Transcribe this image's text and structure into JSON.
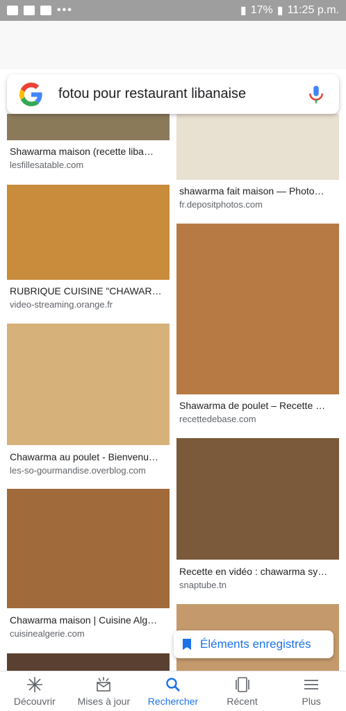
{
  "status_bar": {
    "battery": "17%",
    "time": "11:25 p.m.",
    "overflow": "•••"
  },
  "search": {
    "query": "fotou pour restaurant libanaise"
  },
  "results": [
    {
      "title": "Shawarma maison (recette liba…",
      "source": "lesfillesatable.com",
      "thumb_color": "#8a7a5a"
    },
    {
      "title": "shawarma fait maison — Photo…",
      "source": "fr.depositphotos.com",
      "thumb_color": "#e8e0d0"
    },
    {
      "title": "RUBRIQUE CUISINE \"CHAWAR…",
      "source": "video-streaming.orange.fr",
      "thumb_color": "#c88c3c"
    },
    {
      "title": "Shawarma de poulet – Recette …",
      "source": "recettedebase.com",
      "thumb_color": "#b87a44"
    },
    {
      "title": "Chawarma au poulet - Bienvenu…",
      "source": "les-so-gourmandise.overblog.com",
      "thumb_color": "#d6b27a"
    },
    {
      "title": "Recette en vidéo : chawarma sy…",
      "source": "snaptube.tn",
      "thumb_color": "#7a5a3a"
    },
    {
      "title": "Chawarma maison | Cuisine Alg…",
      "source": "cuisinealgerie.com",
      "thumb_color": "#a06a3a"
    }
  ],
  "saved_button": {
    "label": "Éléments enregistrés"
  },
  "bottom_nav": [
    {
      "label": "Découvrir",
      "icon": "asterisk-icon"
    },
    {
      "label": "Mises à jour",
      "icon": "updates-icon"
    },
    {
      "label": "Rechercher",
      "icon": "search-icon",
      "active": true
    },
    {
      "label": "Récent",
      "icon": "recent-icon"
    },
    {
      "label": "Plus",
      "icon": "menu-icon"
    }
  ],
  "colors": {
    "accent": "#1a73e8",
    "text": "#202124",
    "muted": "#5f6368"
  }
}
